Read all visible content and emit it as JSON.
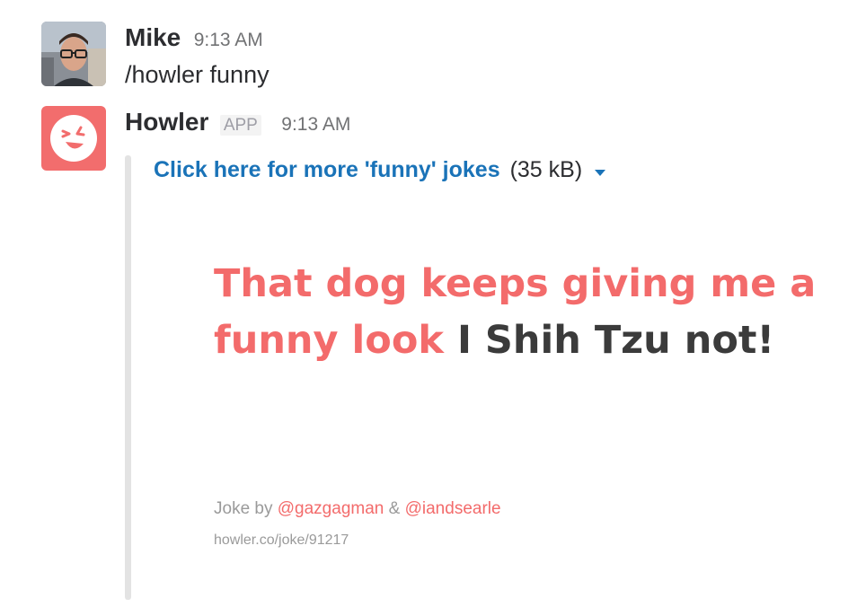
{
  "messages": [
    {
      "author": "Mike",
      "time": "9:13 AM",
      "text": "/howler funny",
      "avatar_icon": "user-photo"
    },
    {
      "author": "Howler",
      "badge": "APP",
      "time": "9:13 AM",
      "avatar_icon": "laughing-face-icon",
      "brand_color": "#f26d6d",
      "attachment": {
        "link_text": "Click here for more 'funny' jokes",
        "size": "(35 kB)",
        "joke_setup": "That dog keeps giving me a funny look",
        "joke_punchline": "I Shih Tzu not!",
        "credit_prefix": "Joke by",
        "credit_author_1": "@gazgagman",
        "credit_and": "&",
        "credit_author_2": "@iandsearle",
        "url": "howler.co/joke/91217"
      }
    }
  ],
  "colors": {
    "link": "#1a73b8",
    "joke_accent": "#f36b6b",
    "joke_dark": "#3b3b3b"
  }
}
